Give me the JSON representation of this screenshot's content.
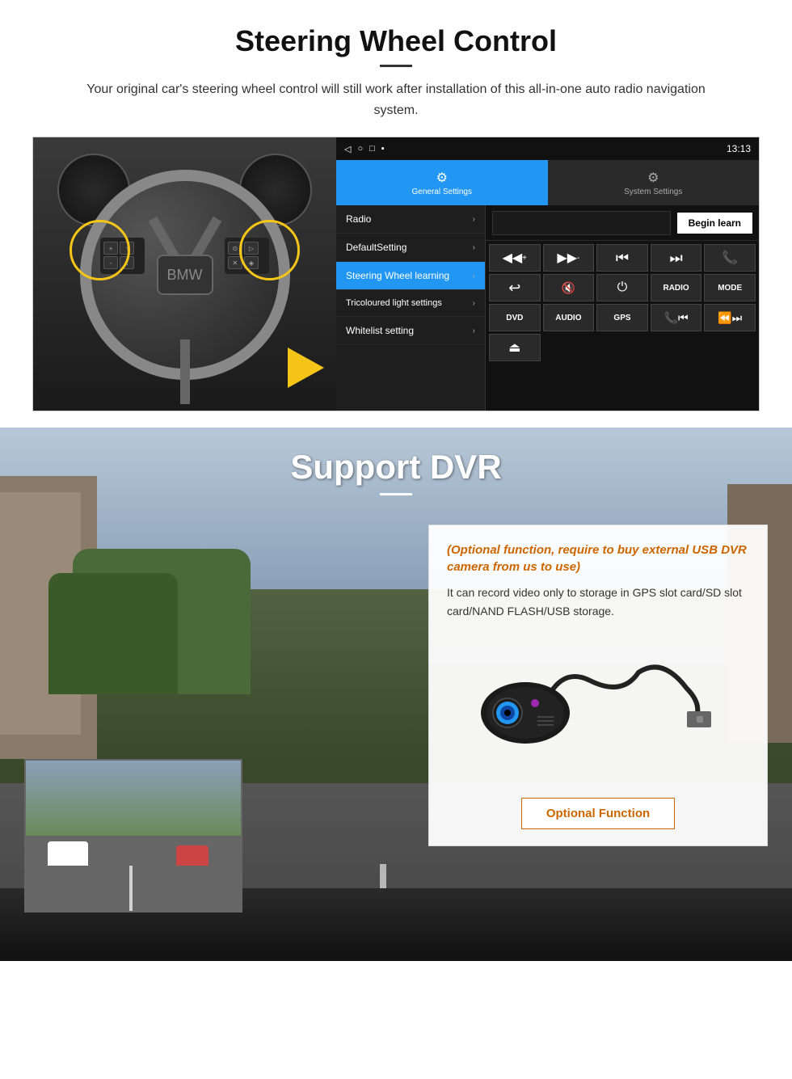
{
  "section1": {
    "title": "Steering Wheel Control",
    "subtitle": "Your original car's steering wheel control will still work after installation of this all-in-one auto radio navigation system.",
    "ui": {
      "statusbar": {
        "icons": [
          "◁",
          "○",
          "□",
          "▪"
        ],
        "time": "13:13",
        "signal": "▼"
      },
      "tabs": [
        {
          "icon": "⚙",
          "label": "General Settings",
          "active": true
        },
        {
          "icon": "⚙",
          "label": "System Settings",
          "active": false
        }
      ],
      "menu": [
        {
          "label": "Radio",
          "active": false
        },
        {
          "label": "DefaultSetting",
          "active": false
        },
        {
          "label": "Steering Wheel learning",
          "active": true
        },
        {
          "label": "Tricoloured light settings",
          "active": false
        },
        {
          "label": "Whitelist setting",
          "active": false
        }
      ],
      "begin_learn": "Begin learn",
      "buttons_row1": [
        "◀◀+",
        "▶▶-",
        "⏮",
        "⏭",
        "📞"
      ],
      "buttons_row2": [
        "↩",
        "🔇",
        "⏻",
        "RADIO",
        "MODE"
      ],
      "buttons_row3": [
        "DVD",
        "AUDIO",
        "GPS",
        "📞⏮",
        "⏪⏭"
      ],
      "buttons_row4": [
        "⏏"
      ]
    }
  },
  "section2": {
    "title": "Support DVR",
    "info_optional": "(Optional function, require to buy external USB DVR camera from us to use)",
    "info_text": "It can record video only to storage in GPS slot card/SD slot card/NAND FLASH/USB storage.",
    "optional_function_btn": "Optional Function"
  }
}
